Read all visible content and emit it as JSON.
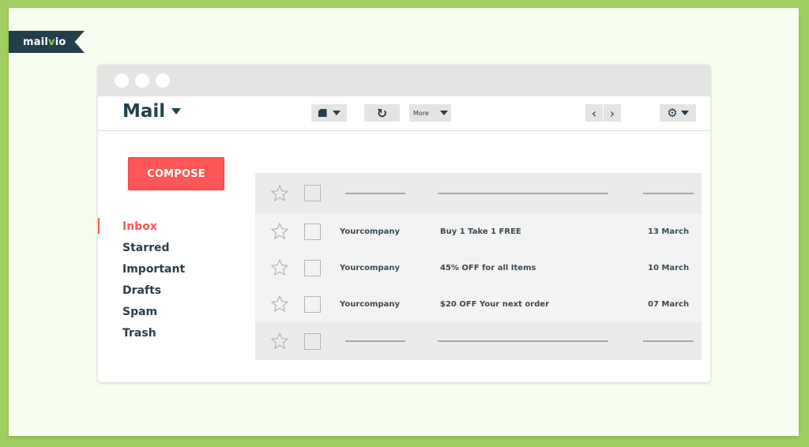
{
  "brand": {
    "logo_prefix": "mail",
    "logo_v": "v",
    "logo_suffix": "io"
  },
  "colors": {
    "background_green": "#9fcf5f",
    "frame": "#f7fdef",
    "accent_red": "#fc5656",
    "navy": "#233f4c"
  },
  "toolbar": {
    "title": "Mail",
    "more_label": "More",
    "refresh_icon": "↻",
    "prev_icon": "‹",
    "next_icon": "›",
    "gear_icon": "⚙"
  },
  "compose_label": "COMPOSE",
  "nav": {
    "items": [
      {
        "label": "Inbox",
        "active": true
      },
      {
        "label": "Starred"
      },
      {
        "label": "Important"
      },
      {
        "label": "Drafts"
      },
      {
        "label": "Spam"
      },
      {
        "label": "Trash"
      }
    ]
  },
  "emails": [
    {
      "sender": "Yourcompany",
      "subject": "Buy 1 Take 1 FREE",
      "date": "13 March"
    },
    {
      "sender": "Yourcompany",
      "subject": "45% OFF for all Items",
      "date": "10 March"
    },
    {
      "sender": "Yourcompany",
      "subject": "$20 OFF Your next order",
      "date": "07 March"
    }
  ]
}
